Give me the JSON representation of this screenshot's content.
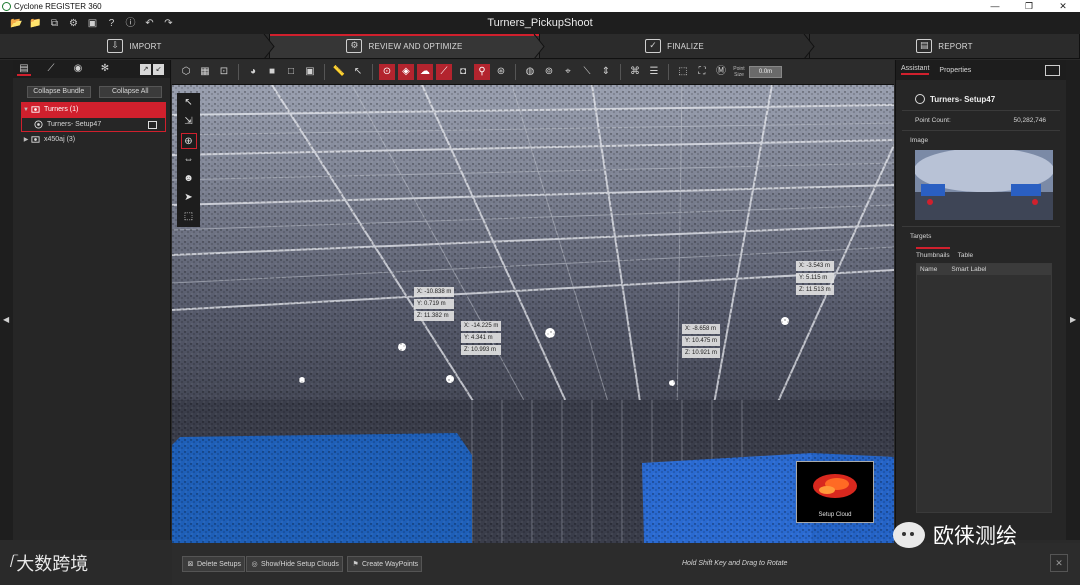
{
  "window": {
    "app_title": "Cyclone REGISTER 360",
    "doc_title": "Turners_PickupShoot",
    "controls": [
      "—",
      "❐",
      "✕"
    ]
  },
  "quick_access": [
    "📂",
    "📁",
    "⧉",
    "⚙",
    "▣",
    "?",
    "ⓘ",
    "↶",
    "↷"
  ],
  "workflow": {
    "steps": [
      {
        "label": "IMPORT",
        "icon": "import-icon",
        "glyph": "⇩"
      },
      {
        "label": "REVIEW AND OPTIMIZE",
        "icon": "review-icon",
        "glyph": "⚙"
      },
      {
        "label": "FINALIZE",
        "icon": "finalize-icon",
        "glyph": "✓"
      },
      {
        "label": "REPORT",
        "icon": "report-icon",
        "glyph": "▤"
      }
    ],
    "active_index": 1
  },
  "left_panel": {
    "tabs": [
      "▤",
      "⟋",
      "◉",
      "✻"
    ],
    "collapse_bundle": "Collapse Bundle",
    "collapse_all": "Collapse All",
    "tree": {
      "bundle": "Turners (1)",
      "setup": "Turners- Setup47",
      "other": "x450aj (3)"
    }
  },
  "view_toolbar": {
    "point_size_label": "Point Size",
    "point_size_value": "0.0m"
  },
  "viewport": {
    "tools": [
      "↖",
      "⇲",
      "⊕",
      "⇔",
      "☻",
      "➤",
      "⬚"
    ],
    "coords": [
      {
        "x": "X: -10.838 m",
        "y": "Y: 0.719 m",
        "z": "Z: 11.382 m"
      },
      {
        "x": "X: -14.225 m",
        "y": "Y: 4.341 m",
        "z": "Z: 10.993 m"
      },
      {
        "x": "X: -8.658 m",
        "y": "Y: 10.475 m",
        "z": "Z: 10.921 m"
      },
      {
        "x": "X: -3.543 m",
        "y": "Y: 5.115 m",
        "z": "Z: 11.513 m"
      }
    ],
    "setup_cloud_label": "Setup Cloud"
  },
  "right_panel": {
    "tabs": [
      "Assistant",
      "Properties"
    ],
    "setup_name": "Turners- Setup47",
    "point_count_label": "Point Count:",
    "point_count_value": "50,282,746",
    "image_heading": "Image",
    "targets_heading": "Targets",
    "targets_tabs": [
      "Thumbnails",
      "Table"
    ],
    "columns": [
      "Name",
      "Smart Label"
    ]
  },
  "bottom_bar": {
    "delete_setups": "Delete Setups",
    "show_hide": "Show/Hide Setup Clouds",
    "create_waypoints": "Create WayPoints",
    "hint": "Hold Shift Key and Drag to Rotate",
    "close": "✕"
  },
  "overlay": {
    "logo_mark": "ᥬ",
    "logo_text": "大数跨境",
    "watermark_text": "欧徕测绘"
  },
  "colors": {
    "accent": "#d0202d",
    "panel": "#262626",
    "toolbar": "#2c2c2c"
  }
}
